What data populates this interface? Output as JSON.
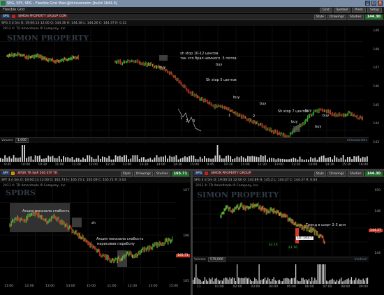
{
  "window": {
    "title": "SPG, SPY, SPG - Flexible Grid Main@thinkorswim [build 1844.9]",
    "minimize": "_",
    "maximize": "□",
    "close": "×"
  },
  "toolbar": {
    "label": "Flexible Grid",
    "buttons": [
      "Grid",
      "Symbol",
      "Prem",
      "Setup"
    ]
  },
  "panels": {
    "top": {
      "symbol": "SPG",
      "company": "SIMON PROPERTY GROUP COM",
      "quote": "SPG 3 d 5m   O: 19:00:13 12:00   O: 144.36   H: 144.38   L: 144.26   C: 144.37   R: 0.12",
      "copyright": "2013 © TD Ameritrade IP Company, Inc.",
      "buttons": [
        "Style",
        "Drawings",
        "Studies"
      ],
      "price": "144.30",
      "watermark": "SIMON PROPERTY",
      "volume_label": "Volume",
      "volume_value": "1,000",
      "volume_right": "mhousandev",
      "yaxis": [
        "149",
        "148",
        "147",
        "146",
        "145",
        "144",
        "143"
      ],
      "xaxis": [
        "9:45",
        "10:00",
        "10:30",
        "11:00",
        "11:30",
        "12:00",
        "12:30",
        "13:00",
        "13:30",
        "14:00",
        "14:30",
        "15:00",
        "9:45",
        "10:30",
        "11:00",
        "12:30",
        "13:00",
        "13:30",
        "14:00",
        "14:30",
        "15:30",
        "16:00"
      ],
      "annotations": [
        "sh stop 10-12 центов",
        "так что брал немного .5 потов",
        "buy",
        "buy",
        "Sh stop 5 центов",
        "buy",
        "buy",
        "buy",
        "Sh stop 7 центов",
        "buy",
        "buy",
        "buy"
      ],
      "wave_labels": [
        "1",
        "2",
        "3",
        "1",
        "2"
      ]
    },
    "bottom_left": {
      "symbol": "SPY",
      "company": "SPDR TR S&P 500 ETF TR",
      "quote": "SPY 3 d 5m   O: 19:00:13 12:00   O: 165.73   H: 165.73   L: 165.69   C: 165.71   R: 0.03",
      "copyright": "2013 © TD Ameritrade IP Company, Inc.",
      "buttons": [
        "Style",
        "Drawings",
        "Studies"
      ],
      "price": "165.71",
      "watermark": "SPDRS",
      "yaxis": [
        "167",
        "166",
        "165"
      ],
      "xaxis": [
        "11:00",
        "12:00",
        "13:00",
        "14:00",
        "15:00",
        "11:00",
        "12:30",
        "13:00",
        "15:00"
      ],
      "last_label": "165.71",
      "annotations": [
        "Акция показала слабость",
        "sh",
        "Акция показала слабость",
        "нарисовав параболу"
      ]
    },
    "bottom_right": {
      "symbol": "SPG",
      "company": "SIMON PROPERTY GROUP",
      "quote": "SPG 3 d 5m   O: 19:00:13 12:00   O: 144.89   H: 145.2   L: 144.37   C: 144.37   R: 0.64",
      "copyright": "2013 © TD Ameritrade IP Company, Inc.",
      "buttons": [
        "Style",
        "Drawings",
        "Studies"
      ],
      "price": "144.30",
      "watermark": "SIMON PROPERTY",
      "yaxis": [
        "150",
        "148",
        "146",
        "144"
      ],
      "xaxis": [
        "11",
        "01:00",
        "02:00",
        "03:00",
        "04:00",
        "05:00",
        "06:00",
        "07:00",
        "08:00",
        "09:00"
      ],
      "annotations": [
        "Тренд в шорт 2-3 дня"
      ],
      "lo_label": "Lo: 143.7",
      "last_label": "144.37",
      "markers": [
        "$2.14",
        "$1.16"
      ],
      "volume_label": "Volume",
      "volume_value": "579,000",
      "volume_right": "medium"
    }
  },
  "colors": {
    "up": "#3cc83c",
    "down": "#d23a2a",
    "neutral": "#c8b428",
    "accent_green": "#1f6b2a",
    "titlebar": "#7a8ea8"
  }
}
